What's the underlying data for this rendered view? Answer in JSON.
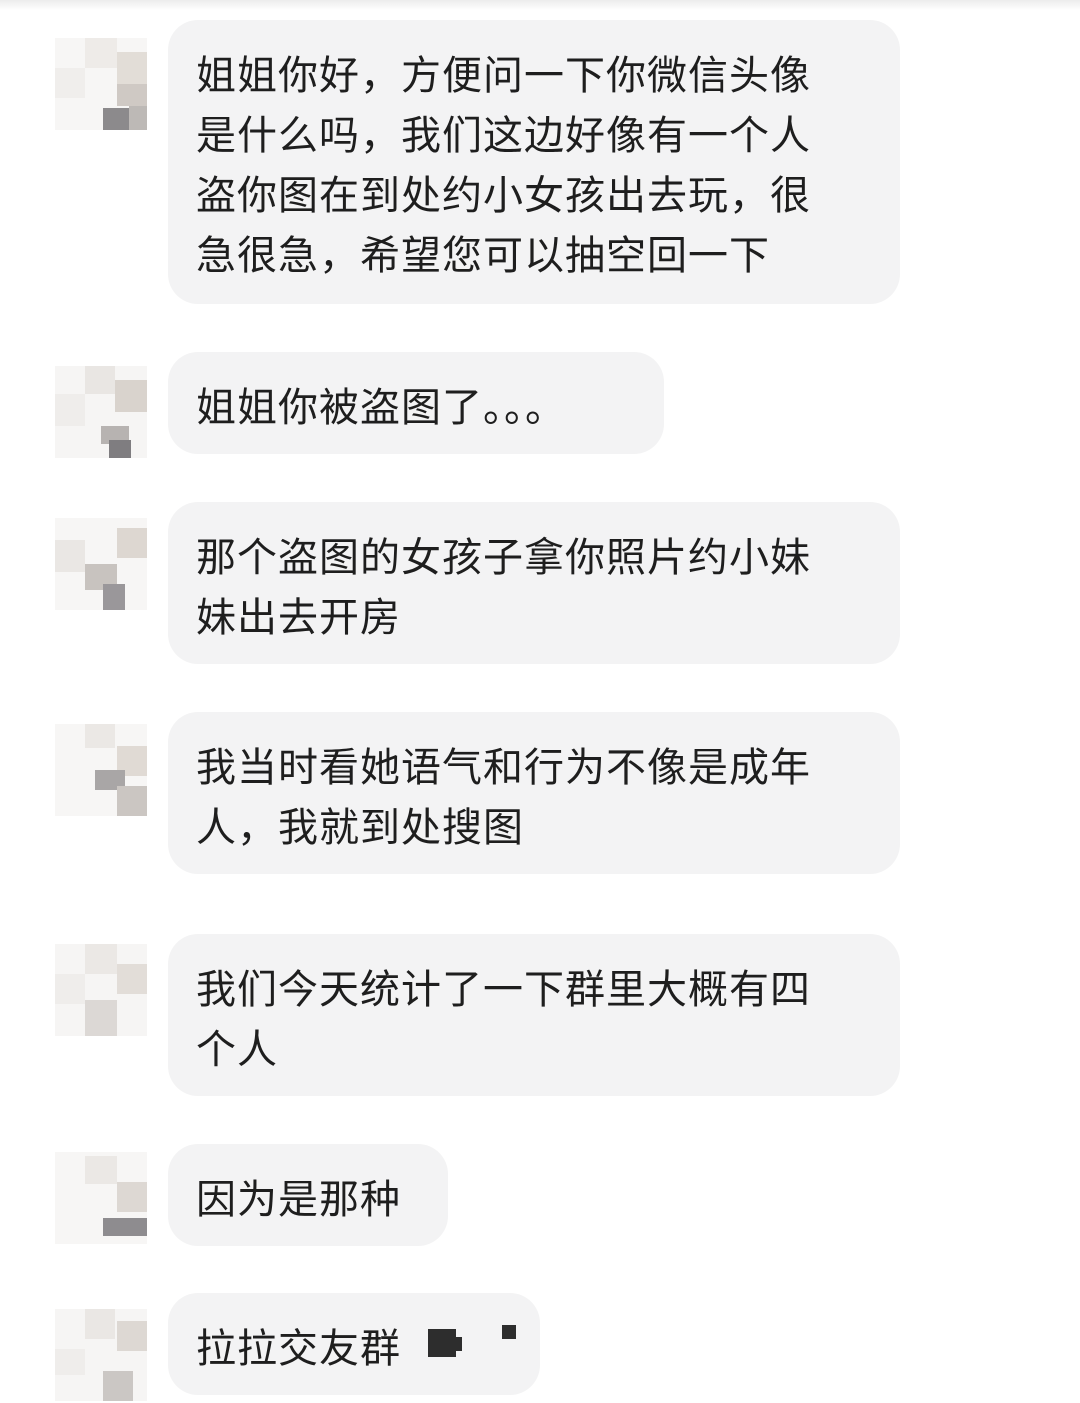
{
  "messages": [
    {
      "lines": [
        "姐姐你好，方便问一下你微信头像",
        "是什么吗，我们这边好像有一个人",
        "盗你图在到处约小女孩出去玩，很",
        "急很急，希望您可以抽空回一下"
      ]
    },
    {
      "lines": [
        "姐姐你被盗图了。。。"
      ]
    },
    {
      "lines": [
        "那个盗图的女孩子拿你照片约小妹",
        "妹出去开房"
      ]
    },
    {
      "lines": [
        "我当时看她语气和行为不像是成年",
        "人，我就到处搜图"
      ]
    },
    {
      "lines": [
        "我们今天统计了一下群里大概有四",
        "个人"
      ]
    },
    {
      "lines": [
        "因为是那种"
      ]
    },
    {
      "lines": [
        "拉拉交友群"
      ]
    }
  ],
  "colors": {
    "background": "#ffffff",
    "bubble": "#f3f3f4",
    "text": "#1e1e1e"
  }
}
